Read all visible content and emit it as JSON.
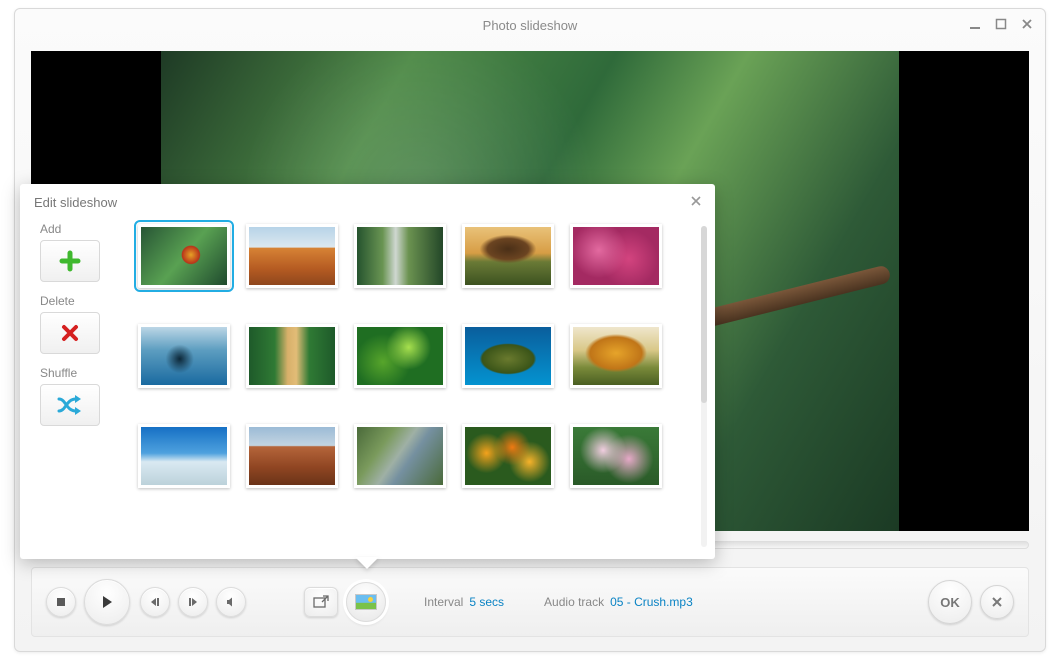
{
  "window": {
    "title": "Photo slideshow"
  },
  "dialog": {
    "title": "Edit slideshow",
    "actions": {
      "add": "Add",
      "delete": "Delete",
      "shuffle": "Shuffle"
    },
    "selected_index": 0,
    "thumbnails": [
      "toucan",
      "desert",
      "waterfall",
      "tree",
      "coral",
      "whale",
      "path",
      "leaves",
      "turtle",
      "autumn",
      "sky",
      "monument",
      "river",
      "flowers",
      "blossom"
    ]
  },
  "toolbar": {
    "interval_label": "Interval",
    "interval_value": "5 secs",
    "audio_label": "Audio track",
    "audio_value": "05 - Crush.mp3",
    "ok_label": "OK"
  }
}
